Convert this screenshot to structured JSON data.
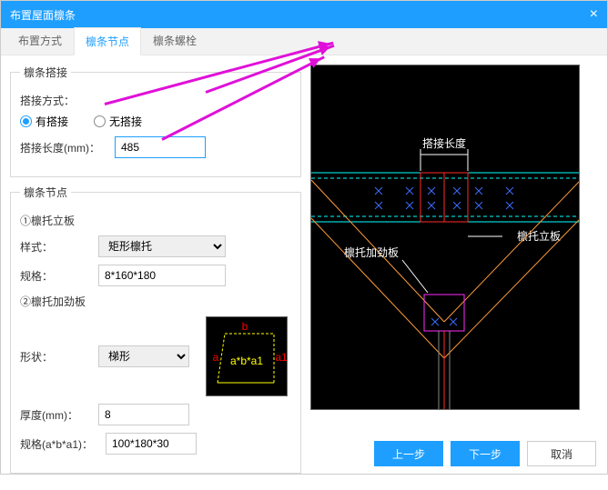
{
  "title": "布置屋面檩条",
  "tabs": [
    {
      "label": "布置方式",
      "active": false
    },
    {
      "label": "檩条节点",
      "active": true
    },
    {
      "label": "檩条螺栓",
      "active": false
    }
  ],
  "group1": {
    "legend": "檩条搭接",
    "methodLabel": "搭接方式：",
    "opt1": "有搭接",
    "opt2": "无搭接",
    "lenLabel": "搭接长度(mm)：",
    "lenValue": "485"
  },
  "group2": {
    "legend": "檩条节点",
    "sub1": "①檩托立板",
    "styleLabel": "样式：",
    "styleValue": "矩形檩托",
    "specLabel": "规格：",
    "specValue": "8*160*180",
    "sub2": "②檩托加劲板",
    "shapeLabel": "形状：",
    "shapeValue": "梯形",
    "thickLabel": "厚度(mm)：",
    "thickValue": "8",
    "spec2Label": "规格(a*b*a1)：",
    "spec2Value": "100*180*30"
  },
  "diag": {
    "lap": "搭接长度",
    "plate": "檩托立板",
    "stiff": "檩托加劲板",
    "formula": "a*b*a1",
    "a": "a",
    "b": "b",
    "a1": "a1"
  },
  "buttons": {
    "prev": "上一步",
    "next": "下一步",
    "cancel": "取消"
  }
}
